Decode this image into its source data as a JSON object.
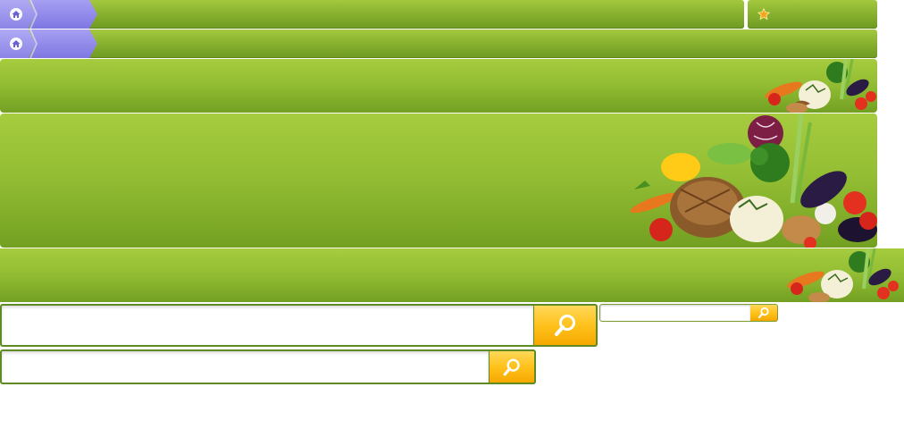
{
  "breadcrumb_bar_1": {
    "home_icon": "home-icon",
    "favorite_icon": "star-icon",
    "colors": {
      "bar_green": "#8ab330",
      "crumb_purple": "#8c84e6",
      "star_orange": "#f7a21b"
    }
  },
  "breadcrumb_bar_2": {
    "home_icon": "home-icon"
  },
  "banners": [
    {
      "image": "vegetables-illustration-small"
    },
    {
      "image": "vegetables-and-meat-illustration-large"
    },
    {
      "image": "vegetables-illustration-small"
    }
  ],
  "search_large": {
    "value": "",
    "placeholder": "",
    "button_icon": "search-icon",
    "button_color": "#ffc21c"
  },
  "search_medium": {
    "value": "",
    "placeholder": "",
    "button_icon": "search-icon"
  },
  "search_small": {
    "value": "",
    "placeholder": "",
    "button_icon": "search-icon"
  }
}
